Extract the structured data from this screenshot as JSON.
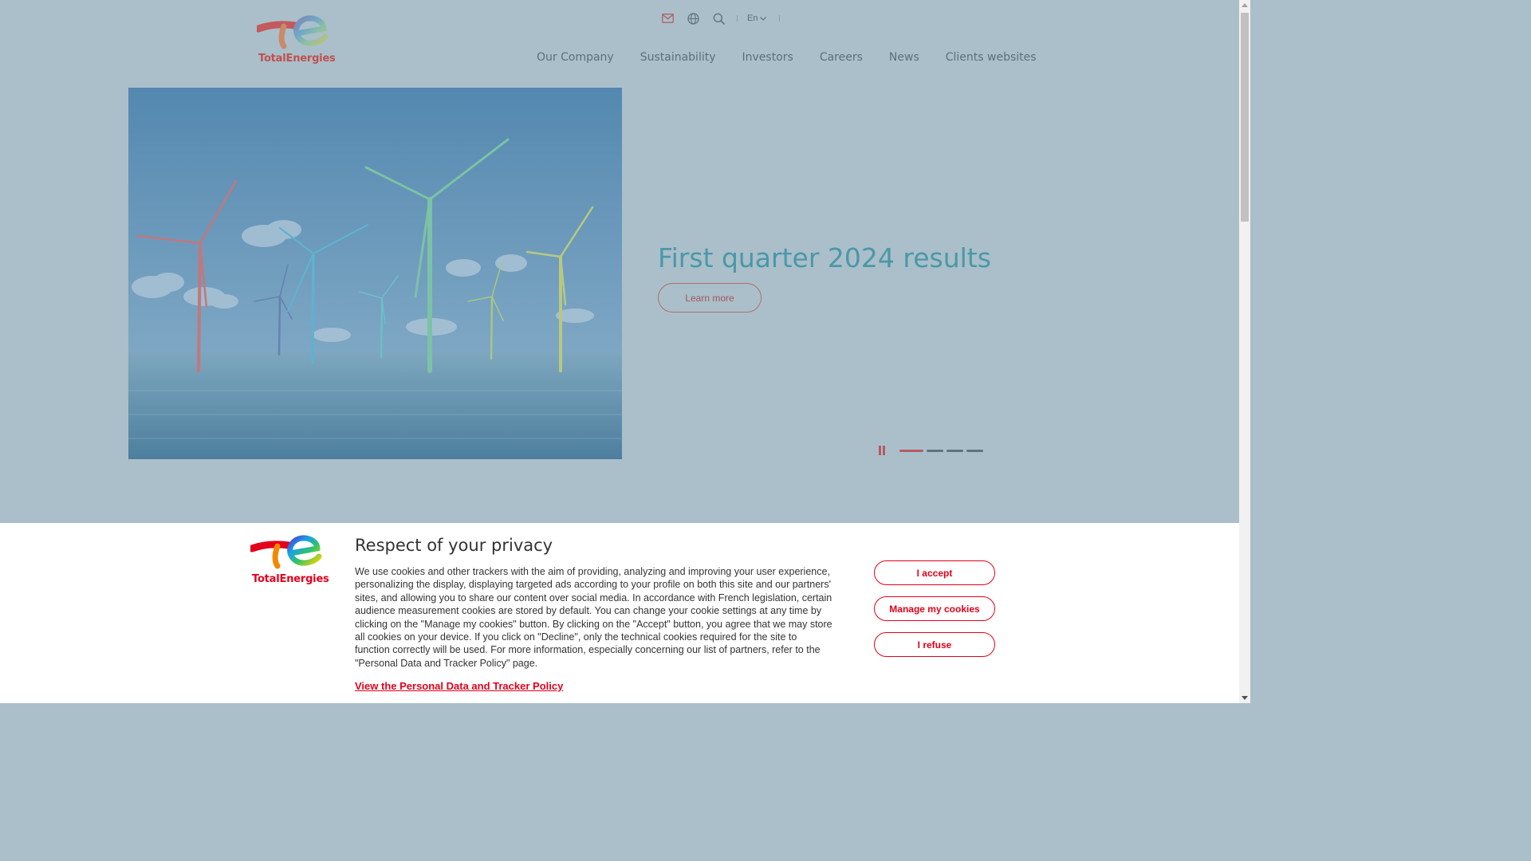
{
  "header": {
    "brand": "TotalEnergies",
    "utility": {
      "mail_icon": "mail-icon",
      "globe_icon": "globe-icon",
      "search_icon": "search-icon",
      "language": "En"
    },
    "nav": [
      {
        "label": "Our Company"
      },
      {
        "label": "Sustainability"
      },
      {
        "label": "Investors"
      },
      {
        "label": "Careers"
      },
      {
        "label": "News"
      },
      {
        "label": "Clients websites"
      }
    ]
  },
  "hero": {
    "title": "First quarter 2024 results",
    "cta": "Learn more",
    "carousel": {
      "slides": 4,
      "active": 1
    }
  },
  "cookie_banner": {
    "brand": "TotalEnergies",
    "title": "Respect of your privacy",
    "text": "We use cookies and other trackers with the aim of providing, analyzing and improving your user experience, personalizing the display, displaying targeted ads according to your profile on both this site and our partners' sites, and allowing you to share our content over social media. In accordance with French legislation, certain audience measurement cookies are stored by default. You can change your cookie settings at any time by clicking on the \"Manage my cookies\" button. By clicking on the \"Accept\" button, you agree that we may store all cookies on your device. If you click on \"Decline\", only the technical cookies required for the site to function correctly will be used. For more information, especially concerning our list of partners, refer to the \"Personal Data and Tracker Policy\" page.",
    "policy_link": "View the Personal Data and Tracker Policy",
    "accept": "I accept",
    "manage": "Manage my cookies",
    "refuse": "I refuse"
  },
  "colors": {
    "brand_red": "#e4001b",
    "overlay": "#aabfc9",
    "title_teal": "#4a98a8"
  }
}
